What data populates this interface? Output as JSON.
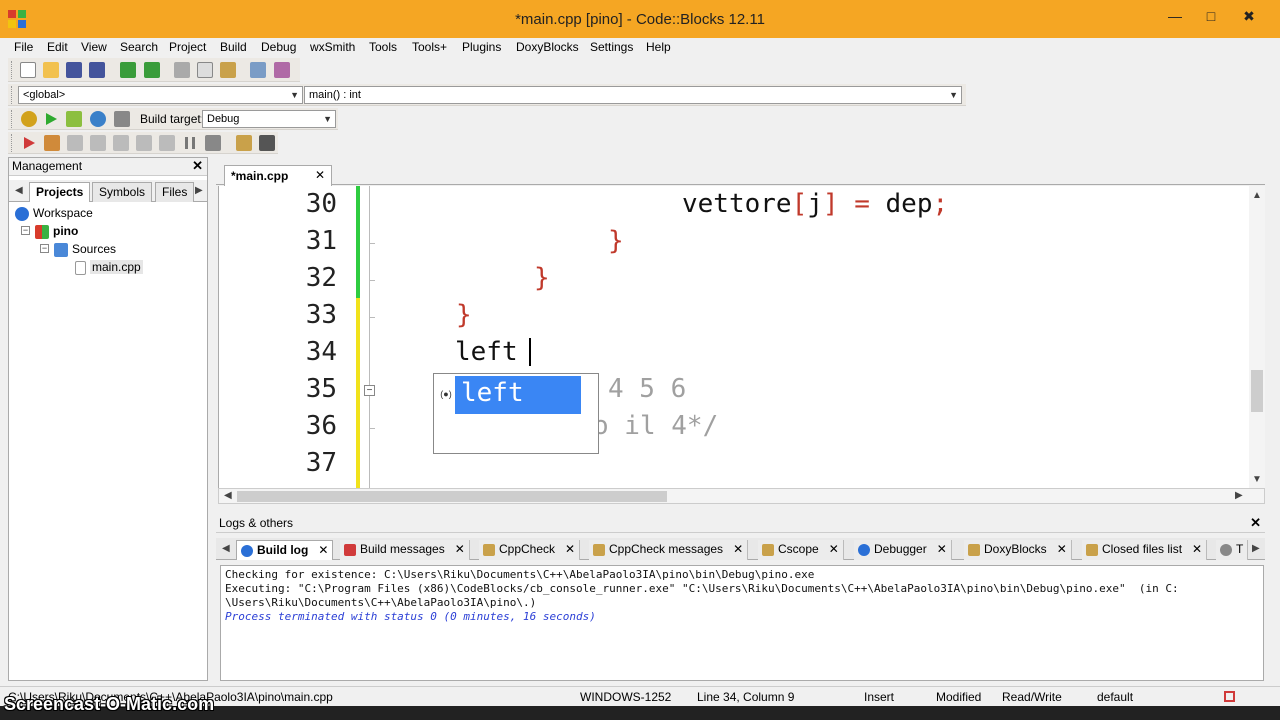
{
  "window": {
    "title": "*main.cpp [pino] - Code::Blocks 12.11",
    "minimize": "—",
    "maximize": "□",
    "close": "✖"
  },
  "menu": [
    "File",
    "Edit",
    "View",
    "Search",
    "Project",
    "Build",
    "Debug",
    "wxSmith",
    "Tools",
    "Tools+",
    "Plugins",
    "DoxyBlocks",
    "Settings",
    "Help"
  ],
  "scope_bar": {
    "scope": "<global>",
    "function": "main() : int"
  },
  "build_toolbar": {
    "target_label": "Build target:",
    "target_value": "Debug"
  },
  "management": {
    "title": "Management",
    "close": "✕",
    "tabs": [
      "Projects",
      "Symbols",
      "Files"
    ],
    "tree": {
      "workspace": "Workspace",
      "project": "pino",
      "folder": "Sources",
      "file": "main.cpp"
    }
  },
  "editor": {
    "tab_label": "*main.cpp",
    "tab_close": "✕",
    "lines": [
      {
        "num": "30"
      },
      {
        "num": "31"
      },
      {
        "num": "32"
      },
      {
        "num": "33"
      },
      {
        "num": "34"
      },
      {
        "num": "35"
      },
      {
        "num": "36"
      },
      {
        "num": "37"
      }
    ],
    "code": {
      "l30a": "vettore",
      "l30b": "[",
      "l30c": "j",
      "l30d": "]",
      "l30e": " = ",
      "l30f": "dep",
      "l30g": ";",
      "l31": "}",
      "l32": "}",
      "l33": "}",
      "l34": "left",
      "l35": "4 5 6",
      "l36": "o il 4*/"
    },
    "fold_box": "−",
    "autocomplete": {
      "item": "left",
      "icon": "(●)"
    }
  },
  "logs": {
    "title": "Logs & others",
    "close": "✕",
    "tabs": [
      {
        "label": "Build log",
        "close": "✕",
        "color": "#2a6fd6"
      },
      {
        "label": "Build messages",
        "close": "✕",
        "color": "#d03a3a"
      },
      {
        "label": "CppCheck",
        "close": "✕",
        "color": "#c9a14a"
      },
      {
        "label": "CppCheck messages",
        "close": "✕",
        "color": "#c9a14a"
      },
      {
        "label": "Cscope",
        "close": "✕",
        "color": "#c9a14a"
      },
      {
        "label": "Debugger",
        "close": "✕",
        "color": "#2a6fd6"
      },
      {
        "label": "DoxyBlocks",
        "close": "✕",
        "color": "#c9a14a"
      },
      {
        "label": "Closed files list",
        "close": "✕",
        "color": "#c9a14a"
      },
      {
        "label": "T",
        "close": "",
        "color": "#888888"
      }
    ],
    "lines": [
      "Checking for existence: C:\\Users\\Riku\\Documents\\C++\\AbelaPaolo3IA\\pino\\bin\\Debug\\pino.exe",
      "Executing: \"C:\\Program Files (x86)\\CodeBlocks/cb_console_runner.exe\" \"C:\\Users\\Riku\\Documents\\C++\\AbelaPaolo3IA\\pino\\bin\\Debug\\pino.exe\"  (in C:",
      "\\Users\\Riku\\Documents\\C++\\AbelaPaolo3IA\\pino\\.)",
      "Process terminated with status 0 (0 minutes, 16 seconds)"
    ]
  },
  "status": {
    "path": "C:\\Users\\Riku\\Documents\\C++\\AbelaPaolo3IA\\pino\\main.cpp",
    "encoding": "WINDOWS-1252",
    "position": "Line 34, Column 9",
    "mode": "Insert",
    "modified": "Modified",
    "access": "Read/Write",
    "profile": "default"
  },
  "watermark": "Screencast-O-Matic.com",
  "colors": {
    "titlebar": "#f5a623",
    "selection": "#3a86f4",
    "operator": "#c0392b",
    "saved_change": "#2ecc40",
    "unsaved_change": "#f1e21b"
  }
}
